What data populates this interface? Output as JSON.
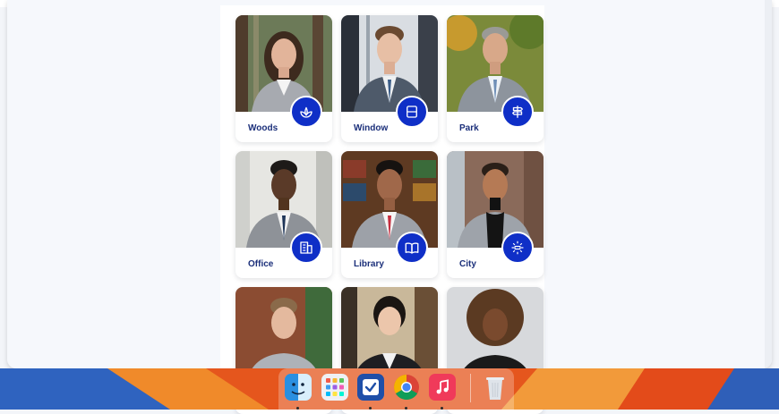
{
  "gallery": {
    "items": [
      {
        "label": "Woods",
        "icon": "lotus-icon"
      },
      {
        "label": "Window",
        "icon": "window-icon"
      },
      {
        "label": "Park",
        "icon": "signpost-icon"
      },
      {
        "label": "Office",
        "icon": "building-icon"
      },
      {
        "label": "Library",
        "icon": "book-icon"
      },
      {
        "label": "City",
        "icon": "city-sun-icon"
      },
      {
        "label": "",
        "icon": ""
      },
      {
        "label": "",
        "icon": ""
      },
      {
        "label": "",
        "icon": ""
      }
    ]
  },
  "dock": {
    "apps": [
      "finder-icon",
      "launchpad-icon",
      "task-app-icon",
      "chrome-icon",
      "music-icon",
      "trash-icon"
    ]
  },
  "colors": {
    "accent": "#0f2fc7",
    "label": "#1b2f7a",
    "wallpaper_orange": "#e85a1e",
    "wallpaper_blue": "#2b67c8"
  }
}
